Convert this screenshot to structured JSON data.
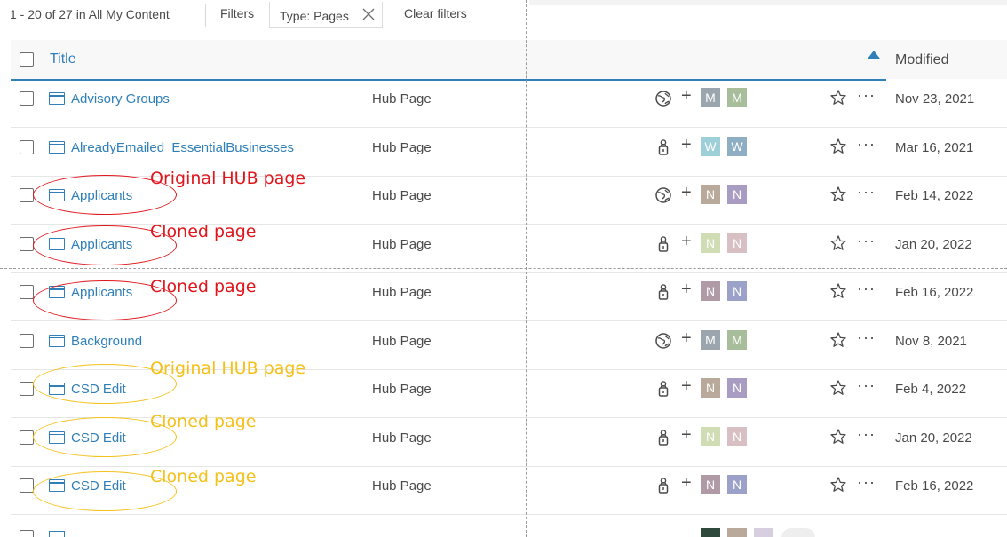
{
  "topbar": {
    "count_text": "1 - 20 of 27 in All My Content",
    "filters_label": "Filters",
    "chip_label": "Type: Pages",
    "clear_label": "Clear filters"
  },
  "table": {
    "header_title": "Title",
    "header_modified": "Modified"
  },
  "rows": [
    {
      "title": "Advisory Groups",
      "type": "Hub Page",
      "share_icon": "globe-icon",
      "avatar1": "M",
      "avatar2": "M",
      "color1": "#9aa5ad",
      "color2": "#a8bd9a",
      "modified": "Nov 23, 2021"
    },
    {
      "title": "AlreadyEmailed_EssentialBusinesses",
      "type": "Hub Page",
      "share_icon": "lock-icon",
      "avatar1": "W",
      "avatar2": "W",
      "color1": "#9ccfd8",
      "color2": "#8eaec3",
      "modified": "Mar 16, 2021"
    },
    {
      "title": "Applicants",
      "type": "Hub Page",
      "share_icon": "globe-icon",
      "avatar1": "N",
      "avatar2": "N",
      "color1": "#b8a99a",
      "color2": "#a99cc3",
      "modified": "Feb 14, 2022"
    },
    {
      "title": "Applicants",
      "type": "Hub Page",
      "share_icon": "lock-icon",
      "avatar1": "N",
      "avatar2": "N",
      "color1": "#cfdcb4",
      "color2": "#d7bfc4",
      "modified": "Jan 20, 2022"
    },
    {
      "title": "Applicants",
      "type": "Hub Page",
      "share_icon": "lock-icon",
      "avatar1": "N",
      "avatar2": "N",
      "color1": "#b09aa6",
      "color2": "#9ca1c9",
      "modified": "Feb 16, 2022"
    },
    {
      "title": "Background",
      "type": "Hub Page",
      "share_icon": "globe-icon",
      "avatar1": "M",
      "avatar2": "M",
      "color1": "#9aa5ad",
      "color2": "#a8bd9a",
      "modified": "Nov 8, 2021"
    },
    {
      "title": "CSD Edit",
      "type": "Hub Page",
      "share_icon": "lock-icon",
      "avatar1": "N",
      "avatar2": "N",
      "color1": "#b8a99a",
      "color2": "#a99cc3",
      "modified": "Feb 4, 2022"
    },
    {
      "title": "CSD Edit",
      "type": "Hub Page",
      "share_icon": "lock-icon",
      "avatar1": "N",
      "avatar2": "N",
      "color1": "#cfdcb4",
      "color2": "#d7bfc4",
      "modified": "Jan 20, 2022"
    },
    {
      "title": "CSD Edit",
      "type": "Hub Page",
      "share_icon": "lock-icon",
      "avatar1": "N",
      "avatar2": "N",
      "color1": "#b09aa6",
      "color2": "#9ca1c9",
      "modified": "Feb 16, 2022"
    }
  ],
  "annotations": {
    "red_original": "Original HUB page",
    "red_cloned_1": "Cloned page",
    "red_cloned_2": "Cloned page",
    "yellow_original": "Original HUB page",
    "yellow_cloned_1": "Cloned page",
    "yellow_cloned_2": "Cloned page",
    "red_color": "#e0161c",
    "yellow_color": "#f5c01a"
  },
  "accent_color": "#2f7fb8"
}
